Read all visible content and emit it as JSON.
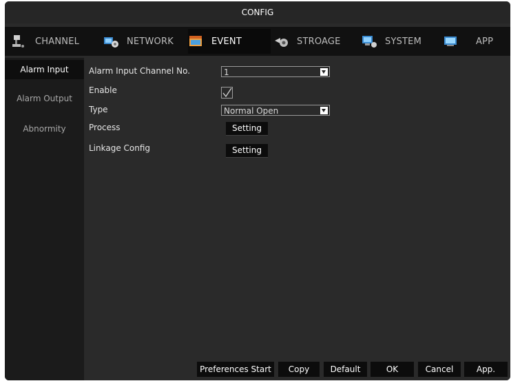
{
  "window": {
    "title": "CONFIG"
  },
  "tabs": [
    {
      "label": "CHANNEL",
      "icon": "channel-icon"
    },
    {
      "label": "NETWORK",
      "icon": "network-icon"
    },
    {
      "label": "EVENT",
      "icon": "event-icon",
      "active": true
    },
    {
      "label": "STROAGE",
      "icon": "storage-icon"
    },
    {
      "label": "SYSTEM",
      "icon": "system-icon"
    },
    {
      "label": "APP",
      "icon": "app-icon"
    }
  ],
  "sidebar": {
    "items": [
      {
        "label": "Alarm Input",
        "active": true
      },
      {
        "label": "Alarm Output"
      },
      {
        "label": "Abnormity"
      }
    ]
  },
  "form": {
    "channel_label": "Alarm Input Channel No.",
    "channel_value": "1",
    "enable_label": "Enable",
    "enable_checked": true,
    "type_label": "Type",
    "type_value": "Normal Open",
    "process_label": "Process",
    "process_button": "Setting",
    "linkage_label": "Linkage Config",
    "linkage_button": "Setting"
  },
  "footer": {
    "preferences": "Preferences Start",
    "copy": "Copy",
    "default": "Default",
    "ok": "OK",
    "cancel": "Cancel",
    "apply": "App."
  },
  "colors": {
    "background": "#2a2a2a",
    "tabbar": "#111111",
    "button": "#0c0c0c",
    "text": "#ffffff"
  }
}
